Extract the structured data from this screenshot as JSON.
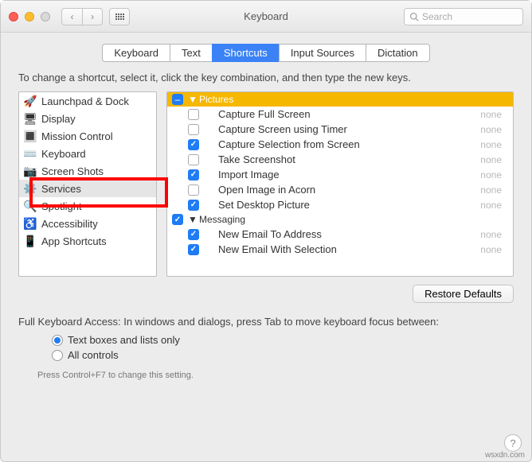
{
  "window": {
    "title": "Keyboard",
    "search_placeholder": "Search"
  },
  "tabs": [
    {
      "label": "Keyboard",
      "active": false
    },
    {
      "label": "Text",
      "active": false
    },
    {
      "label": "Shortcuts",
      "active": true
    },
    {
      "label": "Input Sources",
      "active": false
    },
    {
      "label": "Dictation",
      "active": false
    }
  ],
  "instruction": "To change a shortcut, select it, click the key combination, and then type the new keys.",
  "categories": [
    {
      "label": "Launchpad & Dock",
      "icon": "launchpad"
    },
    {
      "label": "Display",
      "icon": "display"
    },
    {
      "label": "Mission Control",
      "icon": "mission"
    },
    {
      "label": "Keyboard",
      "icon": "keyboard"
    },
    {
      "label": "Screen Shots",
      "icon": "screenshot"
    },
    {
      "label": "Services",
      "icon": "gear",
      "selected": true
    },
    {
      "label": "Spotlight",
      "icon": "spotlight"
    },
    {
      "label": "Accessibility",
      "icon": "accessibility"
    },
    {
      "label": "App Shortcuts",
      "icon": "app"
    }
  ],
  "groups": [
    {
      "label": "Pictures",
      "highlighted": true,
      "checked": "mixed",
      "items": [
        {
          "label": "Capture Full Screen",
          "checked": false,
          "shortcut": "none"
        },
        {
          "label": "Capture Screen using Timer",
          "checked": false,
          "shortcut": "none"
        },
        {
          "label": "Capture Selection from Screen",
          "checked": true,
          "shortcut": "none"
        },
        {
          "label": "Take Screenshot",
          "checked": false,
          "shortcut": "none"
        },
        {
          "label": "Import Image",
          "checked": true,
          "shortcut": "none"
        },
        {
          "label": "Open Image in Acorn",
          "checked": false,
          "shortcut": "none"
        },
        {
          "label": "Set Desktop Picture",
          "checked": true,
          "shortcut": "none"
        }
      ]
    },
    {
      "label": "Messaging",
      "highlighted": false,
      "checked": true,
      "items": [
        {
          "label": "New Email To Address",
          "checked": true,
          "shortcut": "none"
        },
        {
          "label": "New Email With Selection",
          "checked": true,
          "shortcut": "none"
        }
      ]
    }
  ],
  "restore_label": "Restore Defaults",
  "fka": {
    "text": "Full Keyboard Access: In windows and dialogs, press Tab to move keyboard focus between:",
    "options": [
      {
        "label": "Text boxes and lists only",
        "checked": true
      },
      {
        "label": "All controls",
        "checked": false
      }
    ],
    "hint": "Press Control+F7 to change this setting."
  },
  "watermark": "wsxdn.com"
}
